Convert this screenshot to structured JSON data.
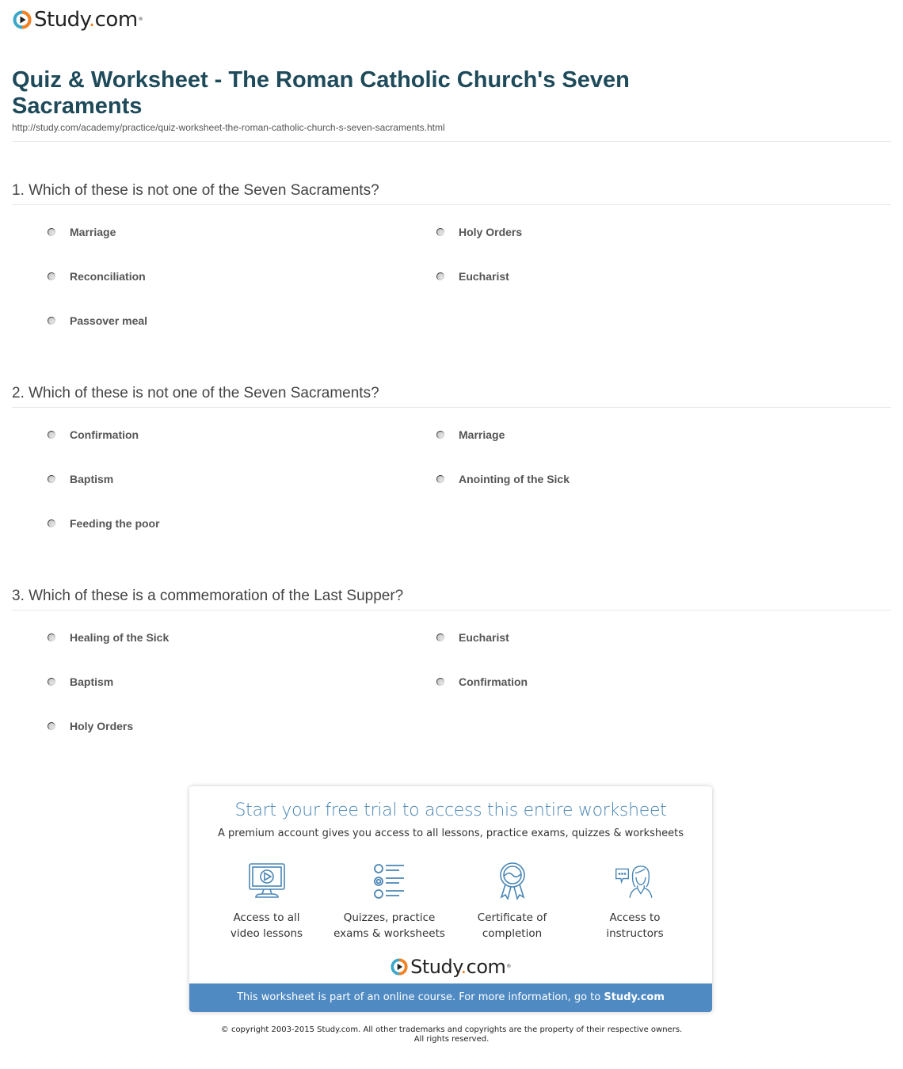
{
  "brand": {
    "name_main": "Study",
    "name_dot": ".",
    "name_tld": "com",
    "colors": {
      "orange": "#f58220",
      "teal": "#3ba7c9",
      "title": "#1e4a5a",
      "accent_blue": "#4a86b5",
      "banner": "#4f8ac2"
    }
  },
  "page": {
    "title": "Quiz & Worksheet - The Roman Catholic Church's Seven Sacraments",
    "url": "http://study.com/academy/practice/quiz-worksheet-the-roman-catholic-church-s-seven-sacraments.html"
  },
  "questions": [
    {
      "text": "1. Which of these is not one of the Seven Sacraments?",
      "options": [
        "Marriage",
        "Holy Orders",
        "Reconciliation",
        "Eucharist",
        "Passover meal"
      ]
    },
    {
      "text": "2. Which of these is not one of the Seven Sacraments?",
      "options": [
        "Confirmation",
        "Marriage",
        "Baptism",
        "Anointing of the Sick",
        "Feeding the poor"
      ]
    },
    {
      "text": "3. Which of these is a commemoration of the Last Supper?",
      "options": [
        "Healing of the Sick",
        "Eucharist",
        "Baptism",
        "Confirmation",
        "Holy Orders"
      ]
    }
  ],
  "promo": {
    "title": "Start your free trial to access this entire worksheet",
    "subtitle": "A premium account gives you access to all lessons, practice exams, quizzes & worksheets",
    "features": [
      {
        "icon": "video-monitor-icon",
        "line1": "Access to all",
        "line2": "video lessons"
      },
      {
        "icon": "quiz-list-icon",
        "line1": "Quizzes, practice",
        "line2": "exams & worksheets"
      },
      {
        "icon": "certificate-ribbon-icon",
        "line1": "Certificate of",
        "line2": "completion"
      },
      {
        "icon": "instructor-chat-icon",
        "line1": "Access to",
        "line2": "instructors"
      }
    ],
    "banner_text": "This worksheet is part of an online course. For more information, go to ",
    "banner_link": "Study.com"
  },
  "footer": {
    "line1": "© copyright 2003-2015 Study.com. All other trademarks and copyrights are the property of their respective owners.",
    "line2": "All rights reserved."
  }
}
